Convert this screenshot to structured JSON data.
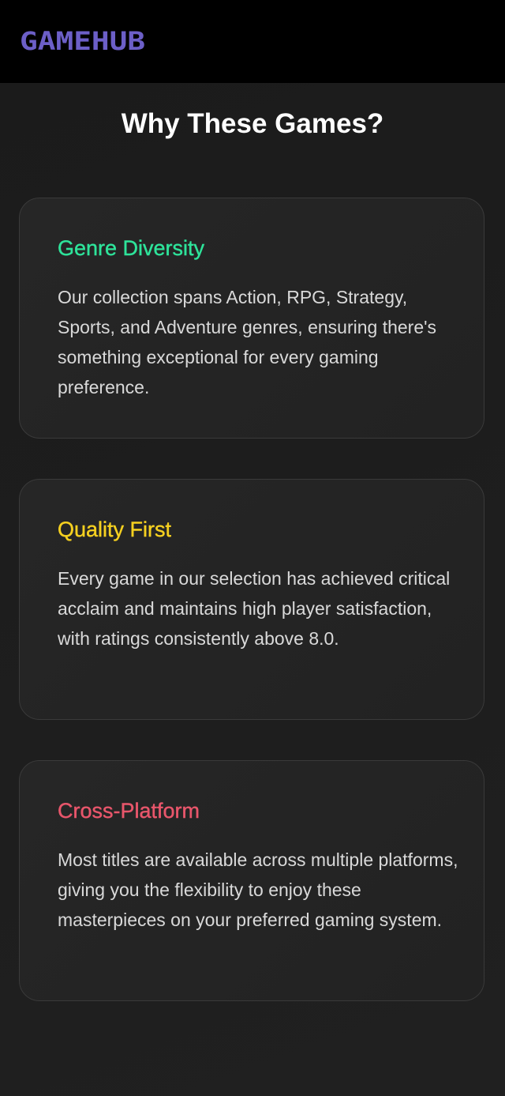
{
  "header": {
    "logo_text": "GAMEHUB",
    "logo_color": "#6c5fc7"
  },
  "section": {
    "title": "Why These Games?"
  },
  "cards": [
    {
      "title": "Genre Diversity",
      "title_color": "#2ee39a",
      "body": "Our collection spans Action, RPG, Strategy, Sports, and Adventure genres, ensuring there's something exceptional for every gaming preference."
    },
    {
      "title": "Quality First",
      "title_color": "#f5d020",
      "body": "Every game in our selection has achieved critical acclaim and maintains high player satisfaction, with ratings consistently above 8.0."
    },
    {
      "title": "Cross-Platform",
      "title_color": "#e8566b",
      "body": "Most titles are available across multiple platforms, giving you the flexibility to enjoy these masterpieces on your preferred gaming system."
    }
  ]
}
